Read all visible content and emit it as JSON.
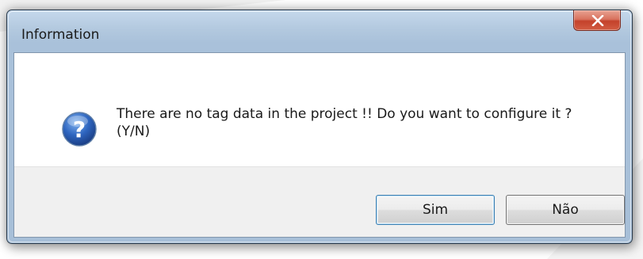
{
  "window": {
    "title": "Information",
    "close_icon": "close-icon"
  },
  "message": {
    "icon": "question-icon",
    "text": "There are no tag data in the project !! Do you want to configure it ?(Y/N)"
  },
  "buttons": {
    "yes_label": "Sim",
    "no_label": "Não"
  },
  "colors": {
    "title_bar": "#a9c1da",
    "close_button": "#c4422b",
    "question_icon": "#2b5cab",
    "button_area": "#f0f0f0"
  }
}
